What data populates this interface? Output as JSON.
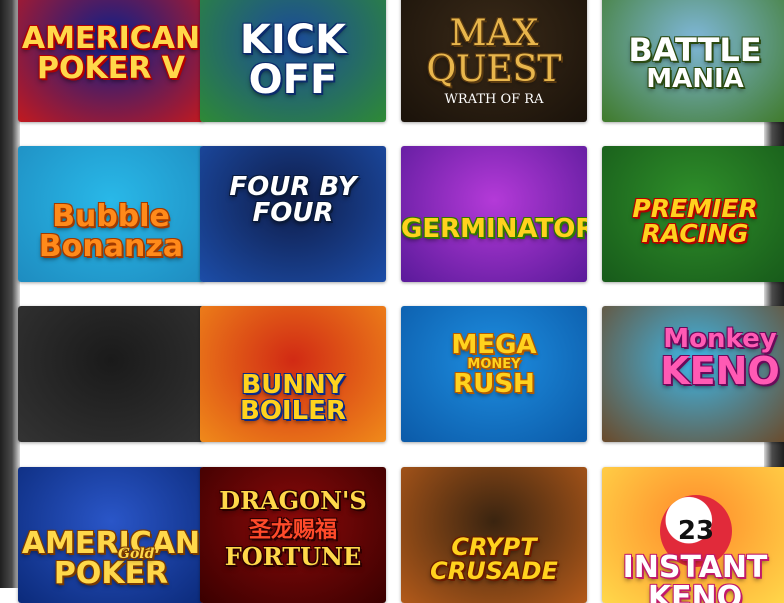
{
  "games": [
    {
      "id": "american-poker-v",
      "title": "AMERICAN POKER V",
      "lines": [
        "AMERICAN",
        "POKER V"
      ],
      "colors": {
        "bg1": "#0c1f8a",
        "bg2": "#c2191f",
        "text": "#ffd84a",
        "stroke": "#b30000"
      }
    },
    {
      "id": "kick-off",
      "title": "KICK OFF",
      "lines": [
        "KICK",
        "OFF"
      ],
      "colors": {
        "bg1": "#1b4a9a",
        "bg2": "#2e8a35",
        "text": "#ffffff",
        "stroke": "#0b2b6b"
      }
    },
    {
      "id": "max-quest",
      "title": "MAX QUEST",
      "lines": [
        "MAX",
        "QUEST"
      ],
      "subtitle": "WRATH OF RA",
      "colors": {
        "bg1": "#3a2a18",
        "bg2": "#1a120a",
        "text": "#e8b64c",
        "stroke": "#5a3a10"
      }
    },
    {
      "id": "battle-mania",
      "title": "BATTLE MANIA",
      "lines": [
        "BATTLE",
        "MANIA"
      ],
      "colors": {
        "bg1": "#7fb7d9",
        "bg2": "#3f7a2a",
        "text": "#ffffff",
        "stroke": "#2a4a10"
      }
    },
    {
      "id": "bubble-bonanza",
      "title": "Bubble Bonanza",
      "lines": [
        "Bubble",
        "Bonanza"
      ],
      "colors": {
        "bg1": "#29b8e8",
        "bg2": "#1e8cc0",
        "text": "#ff8a1a",
        "stroke": "#a13a00"
      }
    },
    {
      "id": "four-by-four",
      "title": "FOUR BY FOUR",
      "lines": [
        "FOUR BY FOUR"
      ],
      "colors": {
        "bg1": "#0f1d4a",
        "bg2": "#1c4da8",
        "text": "#ffffff",
        "stroke": "#0a1a3a"
      }
    },
    {
      "id": "germinator",
      "title": "GERMINATOR",
      "lines": [
        "GERMINATOR"
      ],
      "colors": {
        "bg1": "#b43ad8",
        "bg2": "#5a1a9a",
        "text": "#ffd21e",
        "stroke": "#2f7a00"
      }
    },
    {
      "id": "premier-racing",
      "title": "PREMIER RACING",
      "lines": [
        "PREMIER",
        "RACING"
      ],
      "colors": {
        "bg1": "#2f8f2a",
        "bg2": "#175a1a",
        "text": "#ffd21e",
        "stroke": "#b30000"
      }
    },
    {
      "id": "hexa-game",
      "title": "",
      "lines": [],
      "colors": {
        "bg1": "#1a1a1a",
        "bg2": "#333333",
        "text": "#ffc21a",
        "stroke": "#8a3a00"
      }
    },
    {
      "id": "bunny-boiler",
      "title": "BUNNY BOILER",
      "lines": [
        "BUNNY",
        "BOILER"
      ],
      "colors": {
        "bg1": "#d12a14",
        "bg2": "#f08a1a",
        "text": "#ffd21e",
        "stroke": "#0a2a8a"
      }
    },
    {
      "id": "mega-money-rush",
      "title": "MEGA MONEY RUSH",
      "lines": [
        "MEGA",
        "MONEY",
        "RUSH"
      ],
      "colors": {
        "bg1": "#1e8ee0",
        "bg2": "#0b5aa8",
        "text": "#ffd21e",
        "stroke": "#b35a00"
      }
    },
    {
      "id": "monkey-keno",
      "title": "Monkey KENO",
      "lines": [
        "Monkey",
        "KENO"
      ],
      "colors": {
        "bg1": "#3fb6e6",
        "bg2": "#6a4a2a",
        "text": "#ff5ab4",
        "stroke": "#6a0a5a"
      }
    },
    {
      "id": "american-gold-poker",
      "title": "AMERICAN Gold POKER",
      "lines": [
        "AMERICAN",
        "POKER"
      ],
      "badge": "Gold",
      "colors": {
        "bg1": "#2a56c8",
        "bg2": "#0b2a7a",
        "text": "#ffd84a",
        "stroke": "#7a3a00"
      }
    },
    {
      "id": "dragons-fortune",
      "title": "DRAGON'S FORTUNE",
      "lines": [
        "DRAGON'S",
        "FORTUNE"
      ],
      "chinese": "圣龙赐福",
      "colors": {
        "bg1": "#8a0a0a",
        "bg2": "#3a0000",
        "text": "#ffd84a",
        "stroke": "#2a0000"
      }
    },
    {
      "id": "crypt-crusade",
      "title": "CRYPT CRUSADE",
      "lines": [
        "CRYPT",
        "CRUSADE"
      ],
      "colors": {
        "bg1": "#3a2410",
        "bg2": "#b35a1a",
        "text": "#ffd21e",
        "stroke": "#6a1a00"
      }
    },
    {
      "id": "instant-keno",
      "title": "INSTANT KENO",
      "lines": [
        "INSTANT",
        "KENO"
      ],
      "ball": "23",
      "colors": {
        "bg1": "#ff8a2a",
        "bg2": "#ffd84a",
        "text": "#ffffff",
        "stroke": "#c21a6a"
      }
    }
  ]
}
